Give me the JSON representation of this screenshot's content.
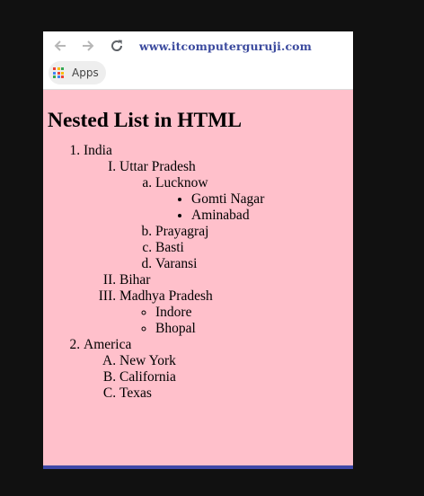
{
  "browser": {
    "url": "www.itcomputerguruji.com",
    "bookmarks": {
      "apps_label": "Apps"
    },
    "icons": {
      "back": "arrow-left-icon",
      "forward": "arrow-right-icon",
      "reload": "reload-icon",
      "apps": "apps-grid-icon"
    },
    "colors": {
      "page_background": "#ffc0cb",
      "url_text": "#3b4a9e",
      "bottom_bar": "#3f48a8",
      "outer_background": "#111111"
    }
  },
  "page": {
    "heading": "Nested List in HTML",
    "list": {
      "india": {
        "label": "India",
        "uttar_pradesh": {
          "label": "Uttar Pradesh",
          "lucknow": {
            "label": "Lucknow",
            "gomti_nagar": "Gomti Nagar",
            "aminabad": "Aminabad"
          },
          "prayagraj": "Prayagraj",
          "basti": "Basti",
          "varansi": "Varansi"
        },
        "bihar": "Bihar",
        "madhya_pradesh": {
          "label": "Madhya Pradesh",
          "indore": "Indore",
          "bhopal": "Bhopal"
        }
      },
      "america": {
        "label": "America",
        "new_york": "New York",
        "california": "California",
        "texas": "Texas"
      }
    }
  }
}
